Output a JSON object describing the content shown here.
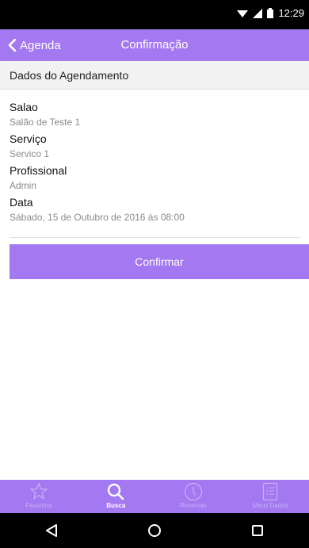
{
  "status_bar": {
    "time": "12:29"
  },
  "header": {
    "back_label": "Agenda",
    "title": "Confirmação"
  },
  "section": {
    "title": "Dados do Agendamento"
  },
  "details": [
    {
      "label": "Salao",
      "value": "Salão de Teste 1"
    },
    {
      "label": "Serviço",
      "value": "Servico 1"
    },
    {
      "label": "Profissional",
      "value": "Admin"
    },
    {
      "label": "Data",
      "value": "Sábado, 15 de Outubro de 2016 às 08:00"
    }
  ],
  "confirm_button": {
    "label": "Confirmar"
  },
  "tabs": [
    {
      "label": "Favoritos",
      "icon": "star-icon",
      "active": false
    },
    {
      "label": "Busca",
      "icon": "search-icon",
      "active": true
    },
    {
      "label": "Reservas",
      "icon": "clock-icon",
      "active": false
    },
    {
      "label": "Meus Dados",
      "icon": "list-icon",
      "active": false
    }
  ],
  "colors": {
    "accent": "#a378f0",
    "tab_inactive": "#c9b1f7"
  }
}
